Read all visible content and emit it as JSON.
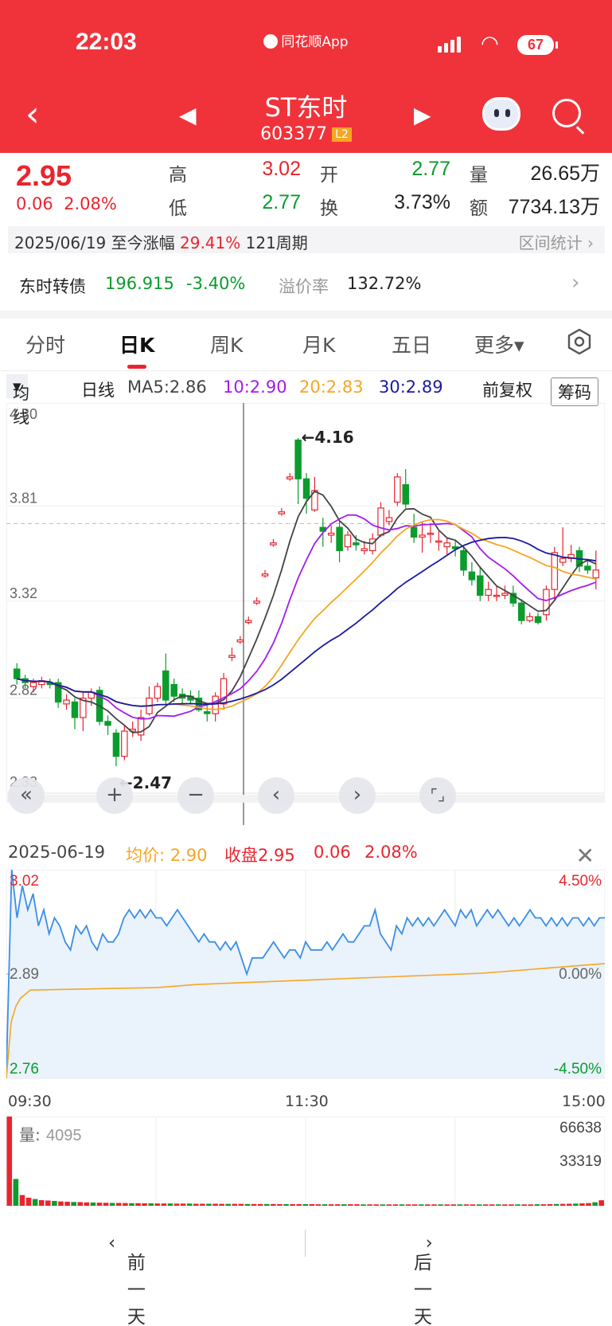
{
  "status": {
    "time": "22:03",
    "app_name": "同花顺App",
    "battery": "67"
  },
  "header": {
    "back_icon": "chevron-left-icon",
    "name": "ST东时",
    "code": "603377",
    "level_badge": "L2"
  },
  "quote": {
    "price": "2.95",
    "change": "0.06",
    "change_pct": "2.08%",
    "high_label": "高",
    "high": "3.02",
    "open_label": "开",
    "open": "2.77",
    "volume_label": "量",
    "volume": "26.65万",
    "low_label": "低",
    "low": "2.77",
    "turnover_label": "换",
    "turnover": "3.73%",
    "amount_label": "额",
    "amount": "7734.13万"
  },
  "range": {
    "date": "2025/06/19",
    "text": "至今涨幅",
    "pct": "29.41%",
    "periods": "121周期",
    "stats_label": "区间统计"
  },
  "bond": {
    "name": "东时转债",
    "price": "196.915",
    "change": "-3.40%",
    "premium_label": "溢价率",
    "premium": "132.72%"
  },
  "tabs": [
    {
      "label": "分时"
    },
    {
      "label": "日K"
    },
    {
      "label": "周K"
    },
    {
      "label": "月K"
    },
    {
      "label": "五日"
    },
    {
      "label": "更多▾"
    }
  ],
  "ma": {
    "selector": "均线",
    "period": "日线",
    "ma5": "MA5:2.86",
    "ma10": "10:2.90",
    "ma20": "20:2.83",
    "ma30": "30:2.89",
    "adjust": "前复权",
    "chip": "筹码",
    "colors": {
      "ma5": "#444444",
      "ma10": "#a31cf0",
      "ma20": "#f5a623",
      "ma30": "#1a1aa0"
    }
  },
  "chart_data": [
    {
      "type": "candlestick",
      "y_ticks": [
        "4.30",
        "3.81",
        "3.32",
        "2.82",
        "2.33"
      ],
      "ylim": [
        2.33,
        4.3
      ],
      "max_annotation": "←4.16",
      "min_annotation": "←2.47",
      "candles": [
        [
          2.97,
          2.92,
          3.0,
          2.89
        ],
        [
          2.92,
          2.9,
          2.94,
          2.87
        ],
        [
          2.88,
          2.9,
          2.92,
          2.85
        ],
        [
          2.89,
          2.91,
          2.93,
          2.87
        ],
        [
          2.9,
          2.89,
          2.92,
          2.87
        ],
        [
          2.9,
          2.8,
          2.92,
          2.77
        ],
        [
          2.79,
          2.81,
          2.84,
          2.76
        ],
        [
          2.8,
          2.72,
          2.82,
          2.66
        ],
        [
          2.72,
          2.82,
          2.85,
          2.65
        ],
        [
          2.82,
          2.85,
          2.87,
          2.78
        ],
        [
          2.86,
          2.7,
          2.88,
          2.68
        ],
        [
          2.7,
          2.68,
          2.73,
          2.63
        ],
        [
          2.64,
          2.52,
          2.66,
          2.47
        ],
        [
          2.52,
          2.65,
          2.68,
          2.5
        ],
        [
          2.65,
          2.66,
          2.7,
          2.62
        ],
        [
          2.63,
          2.72,
          2.76,
          2.6
        ],
        [
          2.74,
          2.82,
          2.88,
          2.73
        ],
        [
          2.82,
          2.88,
          2.9,
          2.8
        ],
        [
          2.96,
          2.81,
          3.05,
          2.79
        ],
        [
          2.89,
          2.83,
          2.92,
          2.8
        ],
        [
          2.84,
          2.82,
          2.87,
          2.78
        ],
        [
          2.83,
          2.81,
          2.86,
          2.79
        ],
        [
          2.82,
          2.76,
          2.86,
          2.75
        ],
        [
          2.75,
          2.74,
          2.78,
          2.7
        ],
        [
          2.74,
          2.83,
          2.85,
          2.7
        ],
        [
          2.79,
          2.92,
          2.95,
          2.76
        ],
        [
          3.03,
          3.04,
          3.08,
          3.01
        ],
        [
          3.11,
          3.12,
          3.14,
          3.1
        ],
        [
          3.21,
          3.22,
          3.24,
          3.2
        ],
        [
          3.31,
          3.32,
          3.34,
          3.3
        ],
        [
          3.45,
          3.46,
          3.48,
          3.44
        ],
        [
          3.61,
          3.62,
          3.64,
          3.6
        ],
        [
          3.77,
          3.78,
          3.8,
          3.76
        ],
        [
          3.95,
          3.96,
          3.98,
          3.94
        ],
        [
          4.15,
          3.95,
          4.16,
          3.82
        ],
        [
          3.95,
          3.85,
          3.98,
          3.77
        ],
        [
          3.79,
          3.89,
          3.96,
          3.78
        ],
        [
          3.7,
          3.68,
          3.75,
          3.6
        ],
        [
          3.66,
          3.67,
          3.71,
          3.62
        ],
        [
          3.7,
          3.58,
          3.73,
          3.52
        ],
        [
          3.6,
          3.66,
          3.68,
          3.58
        ],
        [
          3.62,
          3.61,
          3.66,
          3.58
        ],
        [
          3.58,
          3.59,
          3.63,
          3.56
        ],
        [
          3.58,
          3.64,
          3.67,
          3.56
        ],
        [
          3.66,
          3.8,
          3.83,
          3.65
        ],
        [
          3.73,
          3.75,
          3.79,
          3.71
        ],
        [
          3.83,
          3.96,
          3.98,
          3.81
        ],
        [
          3.92,
          3.82,
          4.0,
          3.8
        ],
        [
          3.7,
          3.65,
          3.77,
          3.62
        ],
        [
          3.65,
          3.66,
          3.73,
          3.57
        ],
        [
          3.67,
          3.67,
          3.72,
          3.62
        ],
        [
          3.63,
          3.63,
          3.68,
          3.58
        ],
        [
          3.6,
          3.62,
          3.65,
          3.56
        ],
        [
          3.6,
          3.59,
          3.63,
          3.55
        ],
        [
          3.58,
          3.48,
          3.6,
          3.45
        ],
        [
          3.47,
          3.43,
          3.52,
          3.4
        ],
        [
          3.45,
          3.35,
          3.5,
          3.32
        ],
        [
          3.35,
          3.38,
          3.42,
          3.32
        ],
        [
          3.35,
          3.35,
          3.4,
          3.32
        ],
        [
          3.35,
          3.36,
          3.4,
          3.33
        ],
        [
          3.36,
          3.31,
          3.4,
          3.29
        ],
        [
          3.31,
          3.22,
          3.33,
          3.2
        ],
        [
          3.22,
          3.24,
          3.26,
          3.21
        ],
        [
          3.24,
          3.21,
          3.26,
          3.2
        ],
        [
          3.25,
          3.38,
          3.4,
          3.22
        ],
        [
          3.38,
          3.57,
          3.6,
          3.33
        ],
        [
          3.52,
          3.54,
          3.7,
          3.5
        ],
        [
          3.54,
          3.56,
          3.61,
          3.52
        ],
        [
          3.58,
          3.5,
          3.6,
          3.47
        ],
        [
          3.5,
          3.48,
          3.53,
          3.46
        ],
        [
          3.44,
          3.48,
          3.58,
          3.38
        ]
      ]
    },
    {
      "type": "line",
      "title": "2025-06-19",
      "avg_price_label": "均价: 2.90",
      "close_label": "收盘2.95",
      "close_change": "0.06",
      "close_pct": "2.08%",
      "y_left_labels": [
        "3.02",
        "2.89",
        "2.76"
      ],
      "y_right_labels": [
        "4.50%",
        "0.00%",
        "-4.50%"
      ],
      "x_labels": [
        "09:30",
        "11:30",
        "15:00"
      ],
      "ylim": [
        2.76,
        3.02
      ],
      "prev_close": 2.89,
      "series": [
        {
          "values": [
            2.77,
            3.02,
            2.96,
            3.0,
            2.97,
            2.99,
            2.95,
            2.97,
            2.94,
            2.96,
            2.95,
            2.93,
            2.92,
            2.95,
            2.94,
            2.95,
            2.93,
            2.92,
            2.94,
            2.93,
            2.93,
            2.94,
            2.96,
            2.97,
            2.96,
            2.97,
            2.96,
            2.97,
            2.96,
            2.96,
            2.95,
            2.96,
            2.97,
            2.96,
            2.95,
            2.94,
            2.93,
            2.94,
            2.93,
            2.93,
            2.92,
            2.93,
            2.92,
            2.93,
            2.91,
            2.89,
            2.91,
            2.91,
            2.91,
            2.92,
            2.93,
            2.92,
            2.91,
            2.92,
            2.92,
            2.91,
            2.93,
            2.92,
            2.92,
            2.92,
            2.93,
            2.92,
            2.93,
            2.94,
            2.93,
            2.93,
            2.94,
            2.95,
            2.95,
            2.97,
            2.94,
            2.93,
            2.92,
            2.95,
            2.94,
            2.96,
            2.95,
            2.96,
            2.95,
            2.96,
            2.95,
            2.96,
            2.97,
            2.96,
            2.95,
            2.97,
            2.96,
            2.97,
            2.95,
            2.96,
            2.97,
            2.96,
            2.97,
            2.96,
            2.95,
            2.96,
            2.95,
            2.96,
            2.97,
            2.96,
            2.96,
            2.95,
            2.96,
            2.95,
            2.96,
            2.95,
            2.96,
            2.96,
            2.95,
            2.96,
            2.95,
            2.96,
            2.96
          ]
        },
        {
          "values": [
            2.76,
            2.83,
            2.85,
            2.86,
            2.865,
            2.87,
            2.873,
            2.875,
            2.877,
            2.878,
            2.879,
            2.88,
            2.881,
            2.882,
            2.883,
            2.884,
            2.885,
            2.886,
            2.887,
            2.888,
            2.889,
            2.89,
            2.891,
            2.893,
            2.895,
            2.897,
            2.899,
            2.901,
            2.903
          ]
        }
      ]
    },
    {
      "type": "bar",
      "label": "量:",
      "value_label": "4095",
      "y_labels": [
        "66638",
        "33319"
      ],
      "ylim": [
        0,
        66638
      ],
      "values": [
        66638,
        20000,
        8000,
        6000,
        5000,
        4200,
        3900,
        3600,
        3200,
        3000,
        2800,
        2700,
        2500,
        2400,
        2300,
        2200,
        2100,
        2100,
        2000,
        1900,
        1900,
        1800,
        1800,
        1700,
        1700,
        1700,
        1600,
        1600,
        1600,
        1500,
        1500,
        1500,
        1500,
        1400,
        1400,
        1400,
        1400,
        1300,
        1300,
        1300,
        1300,
        1300,
        1200,
        1200,
        1200,
        1200,
        1200,
        1200,
        1100,
        1100,
        1100,
        1100,
        1100,
        1100,
        1100,
        1000,
        1000,
        1000,
        1000,
        1000,
        1000,
        1000,
        1000,
        1000,
        1000,
        1000,
        1000,
        1000,
        1000,
        1000,
        1000,
        1000,
        1000,
        1000,
        1000,
        1000,
        1000,
        1000,
        1000,
        1000,
        1000,
        1000,
        1100,
        1100,
        1200,
        1300,
        1400,
        1500,
        1600,
        1800,
        2000,
        2600,
        4095
      ]
    }
  ],
  "controls": [
    "rewind-icon",
    "zoom-in-icon",
    "zoom-out-icon",
    "prev-icon",
    "next-icon",
    "fullscreen-icon"
  ],
  "bottom": {
    "prev_day": "前一天",
    "next_day": "后一天"
  }
}
